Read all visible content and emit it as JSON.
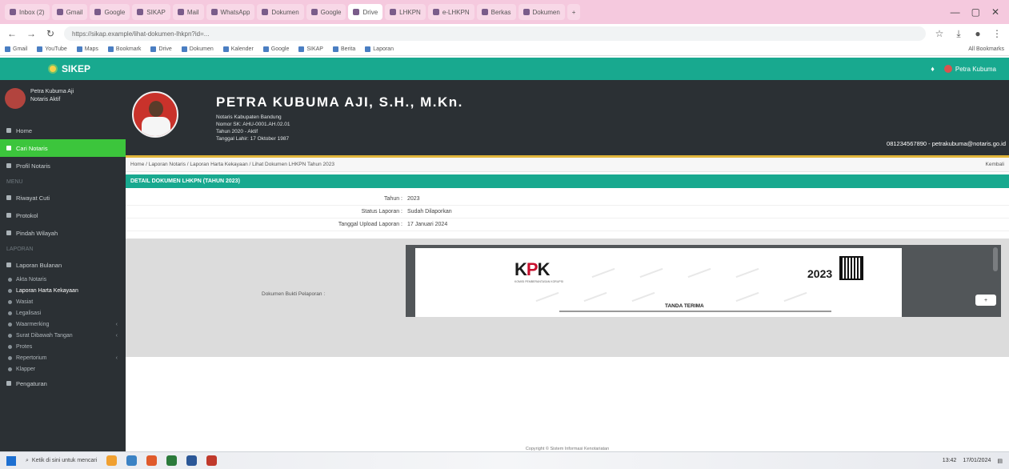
{
  "browser": {
    "tabs": [
      "Inbox (2)",
      "Gmail",
      "Google",
      "SIKAP",
      "Mail",
      "WhatsApp",
      "Dokumen",
      "Google",
      "Drive",
      "LHKPN",
      "e-LHKPN",
      "Berkas",
      "Dokumen"
    ],
    "new_tab_label": "+",
    "win_controls": [
      "—",
      "▢",
      "✕"
    ],
    "url": "https://sikap.example/lihat-dokumen-lhkpn?id=...",
    "bookmarks": [
      "Gmail",
      "YouTube",
      "Maps",
      "Bookmark",
      "Drive",
      "Dokumen",
      "Kalender",
      "Google",
      "SIKAP",
      "Berita",
      "Laporan"
    ],
    "all_bookmarks": "All Bookmarks"
  },
  "app": {
    "logo_text": "SIKEP",
    "user_label": "Petra Kubuma",
    "accent_color": "#18a98f"
  },
  "sidebar": {
    "user_name": "Petra Kubuma Aji",
    "user_role": "Notaris Aktif",
    "items": [
      {
        "label": "Home",
        "active": false
      },
      {
        "label": "Cari Notaris",
        "active": true
      },
      {
        "label": "Profil Notaris",
        "active": false
      }
    ],
    "section1": "MENU",
    "items2": [
      {
        "label": "Riwayat Cuti"
      },
      {
        "label": "Protokol"
      },
      {
        "label": "Pindah Wilayah"
      }
    ],
    "section2": "LAPORAN",
    "items3": [
      {
        "label": "Laporan Bulanan"
      }
    ],
    "subitems": [
      {
        "label": "Akta Notaris",
        "arrow": false
      },
      {
        "label": "Laporan Harta Kekayaan",
        "arrow": false,
        "highlight": true
      },
      {
        "label": "Wasiat",
        "arrow": false
      },
      {
        "label": "Legalisasi",
        "arrow": false
      },
      {
        "label": "Waarmerking",
        "arrow": true
      },
      {
        "label": "Surat Dibawah Tangan",
        "arrow": true
      },
      {
        "label": "Protes",
        "arrow": false
      },
      {
        "label": "Repertorium",
        "arrow": true
      },
      {
        "label": "Klapper",
        "arrow": false
      }
    ],
    "last_item": "Pengaturan"
  },
  "profile": {
    "name": "PETRA KUBUMA AJI, S.H., M.Kn.",
    "lines": [
      "Notaris Kabupaten Bandung",
      "Nomor SK: AHU-0001.AH.02.01",
      "Tahun 2020 - Aktif",
      "Tanggal Lahir: 17 Oktober 1987"
    ],
    "contact": "081234567890 - petrakubuma@notaris.go.id"
  },
  "breadcrumb": {
    "path": "Home / Laporan Notaris / Laporan Harta Kekayaan / Lihat Dokumen LHKPN Tahun 2023",
    "back": "Kembali"
  },
  "panel": {
    "title": "DETAIL DOKUMEN LHKPN (TAHUN 2023)",
    "rows": [
      {
        "label": "Tahun :",
        "value": "2023"
      },
      {
        "label": "Status Laporan :",
        "value": "Sudah Dilaporkan"
      },
      {
        "label": "Tanggal Upload Laporan :",
        "value": "17 Januari 2024"
      }
    ],
    "doc_label": "Dokumen Bukti Pelaporan :"
  },
  "document": {
    "brand": "KPK",
    "brand_sub": "KOMISI PEMBERANTASAN KORUPSI",
    "year": "2023",
    "title": "TANDA TERIMA",
    "zoom_label": "+"
  },
  "footer": "Copyright © Sistem Informasi Kenotariatan",
  "taskbar": {
    "search": "Ketik di sini untuk mencari",
    "time": "13:42",
    "date": "17/01/2024"
  }
}
